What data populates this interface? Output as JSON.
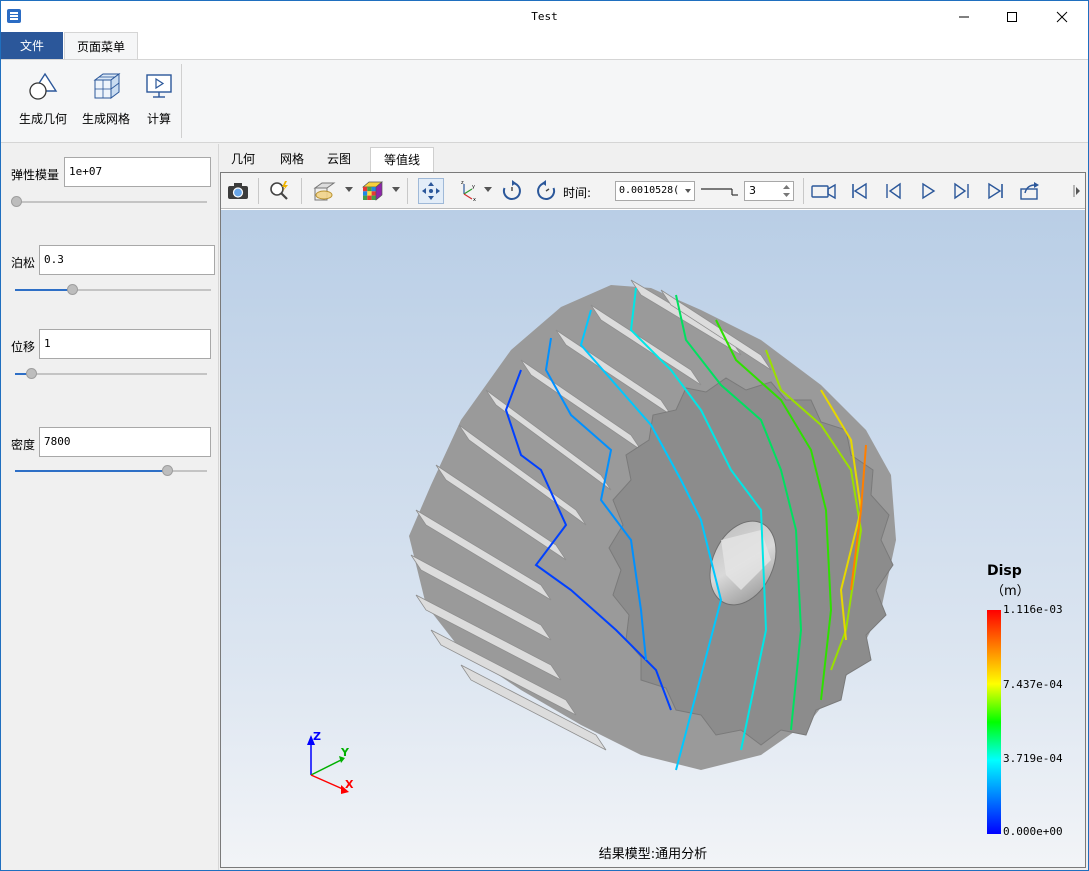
{
  "window": {
    "title": "Test"
  },
  "ribbon": {
    "tabs": [
      "文件",
      "页面菜单"
    ],
    "buttons": [
      "生成几何",
      "生成网格",
      "计算"
    ]
  },
  "params": [
    {
      "label": "弹性模量",
      "value": "1e+07",
      "slider": 0.0
    },
    {
      "label": "泊松",
      "value": "0.3",
      "slider": 0.3
    },
    {
      "label": "位移",
      "value": "1",
      "slider": 0.1
    },
    {
      "label": "密度",
      "value": "7800",
      "slider": 0.8
    }
  ],
  "view_tabs": [
    "几何",
    "网格",
    "云图",
    "等值线"
  ],
  "active_view_tab": "等值线",
  "toolbar": {
    "time_label": "时间:",
    "time_value": "0.0010528(",
    "frame_value": "3"
  },
  "viewer": {
    "caption": "结果模型:通用分析",
    "legend": {
      "title": "Disp",
      "unit": "（m）",
      "ticks": [
        "1.116e-03",
        "7.437e-04",
        "3.719e-04",
        "0.000e+00"
      ]
    },
    "axes": {
      "z": "Z",
      "y": "Y",
      "x": "X"
    }
  },
  "colors": {
    "ribbon_file_tab": "#2b579a",
    "accent": "#2e6fc6"
  }
}
